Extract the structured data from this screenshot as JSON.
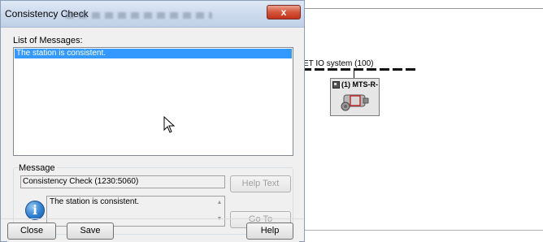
{
  "dialog": {
    "title": "Consistency Check",
    "close_glyph": "x",
    "list_label": "List of Messages:",
    "list_items": [
      "The station is consistent."
    ],
    "message_group_label": "Message",
    "message_id": "Consistency Check (1230:5060)",
    "message_text": "The station is consistent.",
    "info_icon_glyph": "i",
    "help_text_button": "Help Text",
    "goto_button": "Go To",
    "close_button": "Close",
    "save_button": "Save",
    "help_button": "Help"
  },
  "background": {
    "bus_label": "ET IO system (100)",
    "device_label": "(1) MTS-R-",
    "icons": [
      "device-module-icon",
      "device-image-icon"
    ]
  },
  "colors": {
    "selection": "#3399ff",
    "close_button": "#c2341b",
    "info_icon": "#2f7fd0"
  }
}
